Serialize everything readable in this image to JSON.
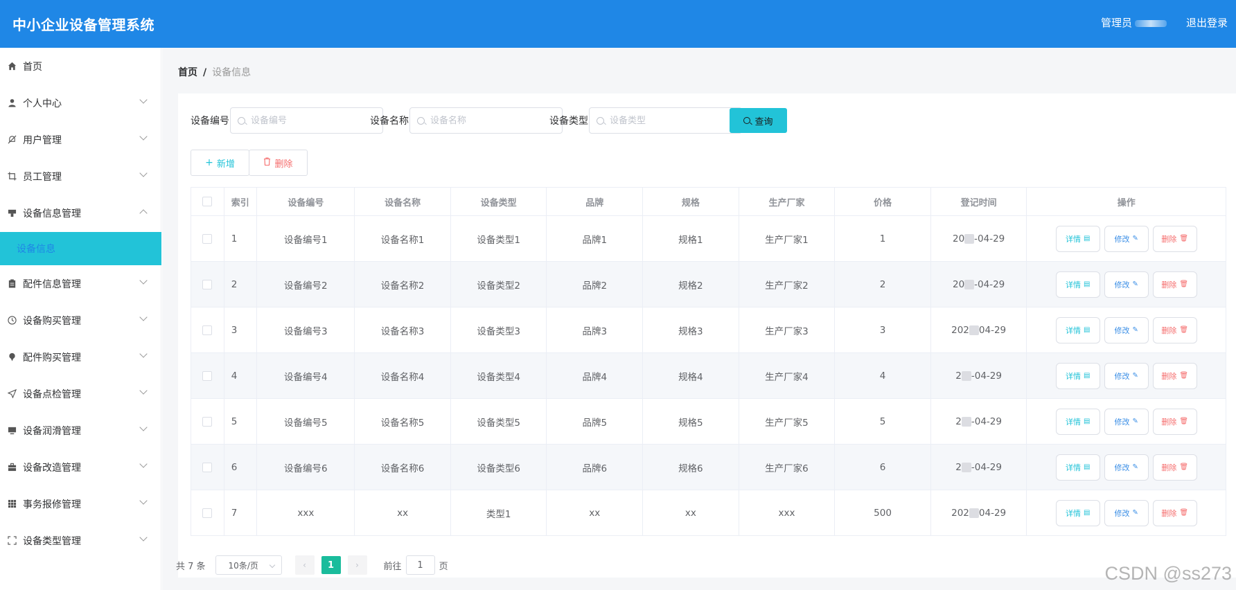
{
  "header": {
    "title": "中小企业设备管理系统",
    "user_label": "管理员",
    "logout": "退出登录"
  },
  "sidebar": {
    "items": [
      {
        "label": "首页",
        "icon": "home-icon",
        "expandable": false
      },
      {
        "label": "个人中心",
        "icon": "user-icon",
        "expandable": true
      },
      {
        "label": "用户管理",
        "icon": "bell-off-icon",
        "expandable": true
      },
      {
        "label": "员工管理",
        "icon": "crop-icon",
        "expandable": true
      },
      {
        "label": "设备信息管理",
        "icon": "stamp-icon",
        "expandable": true,
        "expanded": true
      },
      {
        "label": "配件信息管理",
        "icon": "clipboard-icon",
        "expandable": true
      },
      {
        "label": "设备购买管理",
        "icon": "clock-icon",
        "expandable": true
      },
      {
        "label": "配件购买管理",
        "icon": "pin-icon",
        "expandable": true
      },
      {
        "label": "设备点检管理",
        "icon": "send-icon",
        "expandable": true
      },
      {
        "label": "设备润滑管理",
        "icon": "monitor-icon",
        "expandable": true
      },
      {
        "label": "设备改造管理",
        "icon": "briefcase-icon",
        "expandable": true
      },
      {
        "label": "事务报修管理",
        "icon": "grid-icon",
        "expandable": true
      },
      {
        "label": "设备类型管理",
        "icon": "fullscreen-icon",
        "expandable": true
      }
    ],
    "active_sub": "设备信息"
  },
  "breadcrumb": {
    "home": "首页",
    "separator": "/",
    "current": "设备信息"
  },
  "search": {
    "fields": [
      {
        "label": "设备编号",
        "placeholder": "设备编号",
        "value": ""
      },
      {
        "label": "设备名称",
        "placeholder": "设备名称",
        "value": ""
      },
      {
        "label": "设备类型",
        "placeholder": "设备类型",
        "value": ""
      }
    ],
    "query_button": "查询"
  },
  "actions": {
    "add": "新增",
    "delete": "删除"
  },
  "table": {
    "columns": [
      "索引",
      "设备编号",
      "设备名称",
      "设备类型",
      "品牌",
      "规格",
      "生产厂家",
      "价格",
      "登记时间",
      "操作"
    ],
    "rows": [
      {
        "index": "1",
        "code": "设备编号1",
        "name": "设备名称1",
        "type": "设备类型1",
        "brand": "品牌1",
        "spec": "规格1",
        "maker": "生产厂家1",
        "price": "1",
        "date_prefix": "20",
        "date_suffix": "-04-29"
      },
      {
        "index": "2",
        "code": "设备编号2",
        "name": "设备名称2",
        "type": "设备类型2",
        "brand": "品牌2",
        "spec": "规格2",
        "maker": "生产厂家2",
        "price": "2",
        "date_prefix": "20",
        "date_suffix": "-04-29"
      },
      {
        "index": "3",
        "code": "设备编号3",
        "name": "设备名称3",
        "type": "设备类型3",
        "brand": "品牌3",
        "spec": "规格3",
        "maker": "生产厂家3",
        "price": "3",
        "date_prefix": "202",
        "date_suffix": "04-29"
      },
      {
        "index": "4",
        "code": "设备编号4",
        "name": "设备名称4",
        "type": "设备类型4",
        "brand": "品牌4",
        "spec": "规格4",
        "maker": "生产厂家4",
        "price": "4",
        "date_prefix": "2",
        "date_suffix": "-04-29"
      },
      {
        "index": "5",
        "code": "设备编号5",
        "name": "设备名称5",
        "type": "设备类型5",
        "brand": "品牌5",
        "spec": "规格5",
        "maker": "生产厂家5",
        "price": "5",
        "date_prefix": "2",
        "date_suffix": "-04-29"
      },
      {
        "index": "6",
        "code": "设备编号6",
        "name": "设备名称6",
        "type": "设备类型6",
        "brand": "品牌6",
        "spec": "规格6",
        "maker": "生产厂家6",
        "price": "6",
        "date_prefix": "2",
        "date_suffix": "-04-29"
      },
      {
        "index": "7",
        "code": "xxx",
        "name": "xx",
        "type": "类型1",
        "brand": "xx",
        "spec": "xx",
        "maker": "xxx",
        "price": "500",
        "date_prefix": "202",
        "date_suffix": "04-29"
      }
    ],
    "row_actions": {
      "detail": "详情",
      "edit": "修改",
      "remove": "删除"
    }
  },
  "pagination": {
    "total": "共 7 条",
    "page_size": "10条/页",
    "current_page": "1",
    "goto_label": "前往",
    "goto_value": "1",
    "page_suffix": "页"
  },
  "watermark": "CSDN @ss273",
  "colors": {
    "header": "#1f87e6",
    "accent": "#22c3d8",
    "danger": "#f56c6c",
    "page_active": "#1abc9c"
  }
}
